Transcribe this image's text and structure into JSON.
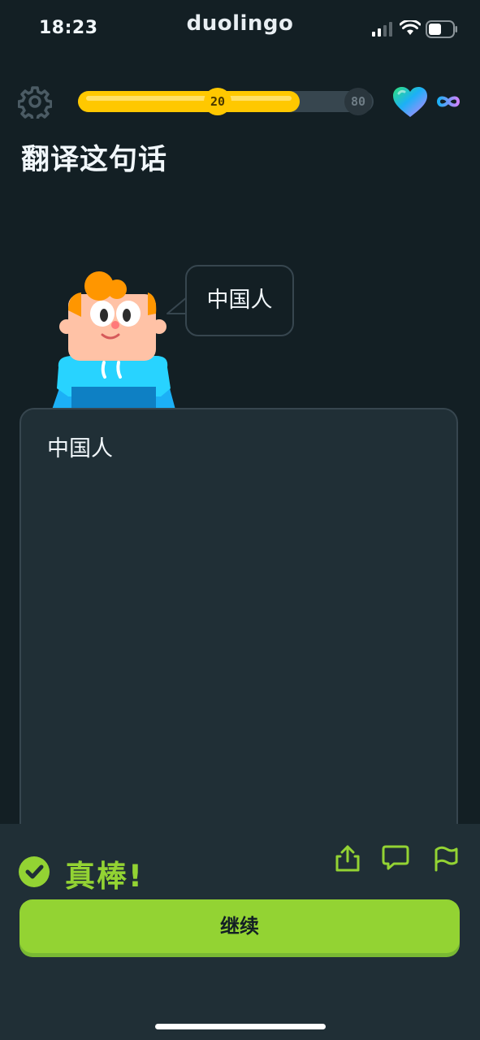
{
  "status_bar": {
    "time": "18:23",
    "brand": "duolingo"
  },
  "lesson_header": {
    "progress": {
      "current": "20",
      "target": "80",
      "fill_fraction": 0.75
    },
    "hearts_icon": "heart-gradient-icon",
    "hearts_value": "∞"
  },
  "prompt": {
    "title": "翻译这句话"
  },
  "character": {
    "speech": "中国人"
  },
  "answer": {
    "text": "中国人"
  },
  "feedback": {
    "title": "真棒!",
    "continue_label": "继续"
  },
  "colors": {
    "background": "#131f24",
    "panel": "#202f36",
    "border": "#37464f",
    "success_green": "#93d333",
    "progress_gold": "#ffc800"
  }
}
